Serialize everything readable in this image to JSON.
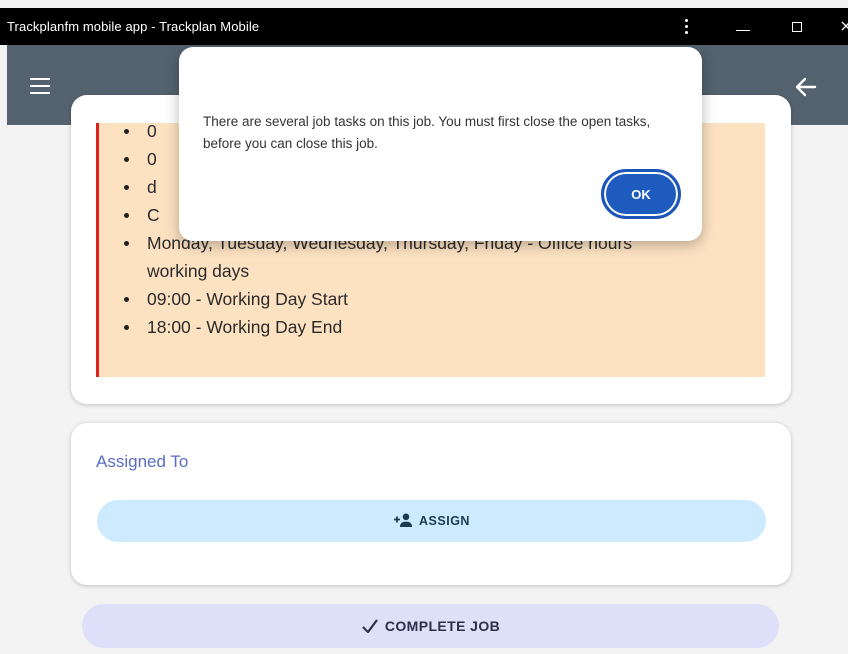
{
  "window": {
    "title": "Trackplanfm mobile app - Trackplan Mobile"
  },
  "appbar": {
    "menu_icon": "hamburger-menu-icon",
    "back_icon": "arrow-left-icon"
  },
  "notice": {
    "items": [
      "0",
      "0",
      "d",
      "C",
      "Monday, Tuesday, Wednesday, Thursday, Friday - Office hours working days",
      "09:00 - Working Day Start",
      "18:00 - Working Day End"
    ],
    "border_color": "#e0201c",
    "background_color": "#fde2c2"
  },
  "assigned": {
    "label": "Assigned To",
    "assign_button_label": "ASSIGN",
    "assign_icon": "person-add-icon"
  },
  "complete_button": {
    "label": "COMPLETE JOB",
    "icon": "checkmark-icon"
  },
  "dialog": {
    "message": "There are several job tasks on this job. You must first close the open tasks, before you can close this job.",
    "ok_label": "OK",
    "ok_color": "#1e5bbf"
  }
}
